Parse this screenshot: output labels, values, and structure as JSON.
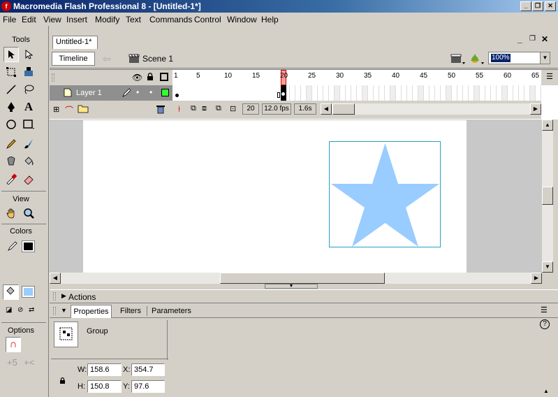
{
  "window": {
    "title": "Macromedia Flash Professional 8 - [Untitled-1*]"
  },
  "menu": [
    "File",
    "Edit",
    "View",
    "Insert",
    "Modify",
    "Text",
    "Commands",
    "Control",
    "Window",
    "Help"
  ],
  "tools": {
    "title": "Tools",
    "view_label": "View",
    "colors_label": "Colors",
    "options_label": "Options",
    "stroke_color": "#000000",
    "fill_color": "#99ccff"
  },
  "document": {
    "tab": "Untitled-1*",
    "timeline_button": "Timeline",
    "scene": "Scene 1",
    "zoom": "100%"
  },
  "timeline": {
    "layer_name": "Layer 1",
    "ruler": [
      "1",
      "5",
      "10",
      "15",
      "20",
      "25",
      "30",
      "35",
      "40",
      "45",
      "50",
      "55",
      "60",
      "65"
    ],
    "current_frame": "20",
    "fps": "12.0 fps",
    "elapsed": "1.6s"
  },
  "stage": {
    "shape_color": "#99ccff",
    "selection_color": "#27a0c4"
  },
  "panels": {
    "actions": "Actions",
    "tabs": [
      "Properties",
      "Filters",
      "Parameters"
    ],
    "object_type": "Group",
    "w_label": "W:",
    "h_label": "H:",
    "x_label": "X:",
    "y_label": "Y:",
    "w": "158.6",
    "h": "150.8",
    "x": "354.7",
    "y": "97.6"
  }
}
